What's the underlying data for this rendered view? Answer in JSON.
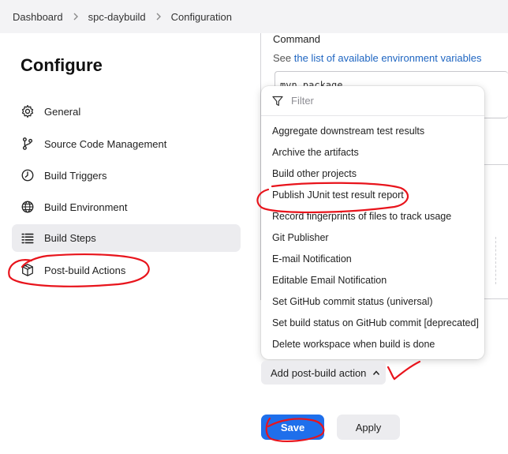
{
  "breadcrumb": {
    "items": [
      "Dashboard",
      "spc-daybuild",
      "Configuration"
    ]
  },
  "sidebar": {
    "title": "Configure",
    "items": [
      {
        "label": "General",
        "icon": "gear-icon"
      },
      {
        "label": "Source Code Management",
        "icon": "branch-icon"
      },
      {
        "label": "Build Triggers",
        "icon": "clock-icon"
      },
      {
        "label": "Build Environment",
        "icon": "globe-icon"
      },
      {
        "label": "Build Steps",
        "icon": "list-icon",
        "active": true
      },
      {
        "label": "Post-build Actions",
        "icon": "package-icon"
      }
    ]
  },
  "main": {
    "command_label": "Command",
    "see_prefix": "See ",
    "see_link": "the list of available environment variables",
    "command_value": "mvn package"
  },
  "dropdown": {
    "filter_placeholder": "Filter",
    "items": [
      "Aggregate downstream test results",
      "Archive the artifacts",
      "Build other projects",
      "Publish JUnit test result report",
      "Record fingerprints of files to track usage",
      "Git Publisher",
      "E-mail Notification",
      "Editable Email Notification",
      "Set GitHub commit status (universal)",
      "Set build status on GitHub commit [deprecated]",
      "Delete workspace when build is done"
    ]
  },
  "actions": {
    "add_post_build": "Add post-build action",
    "save": "Save",
    "apply": "Apply"
  },
  "colors": {
    "accent": "#1f6feb",
    "link": "#1f66c2",
    "annotation": "#e8141c"
  }
}
